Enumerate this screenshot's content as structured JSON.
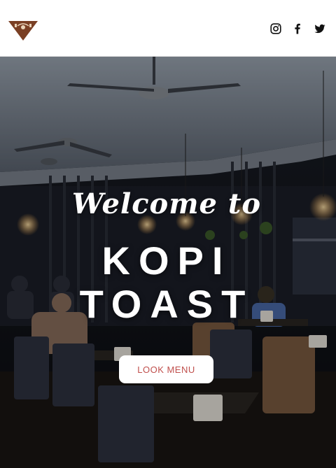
{
  "header": {
    "logo_icon": "kopi-toast-triangle-logo",
    "social": [
      {
        "name": "instagram",
        "icon": "instagram-icon"
      },
      {
        "name": "facebook",
        "icon": "facebook-icon"
      },
      {
        "name": "twitter",
        "icon": "twitter-icon"
      }
    ]
  },
  "hero": {
    "welcome": "Welcome to",
    "brand_line_1": "KOPI",
    "brand_line_2": "TOAST",
    "cta_label": "LOOK MENU"
  },
  "colors": {
    "logo_brown": "#7a3f24",
    "cta_text": "#c0504d",
    "hero_dark": "#141821"
  }
}
